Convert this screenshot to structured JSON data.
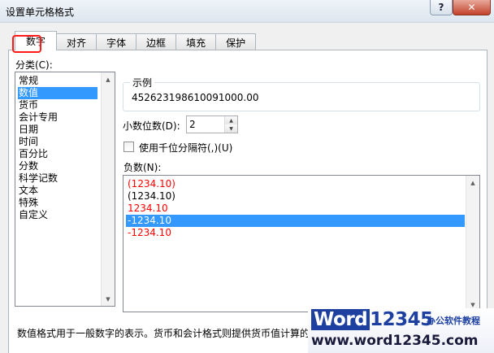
{
  "window": {
    "title": "设置单元格格式",
    "help_label": "?",
    "close_label": "✕"
  },
  "tabs": [
    {
      "label": "数字",
      "active": true
    },
    {
      "label": "对齐"
    },
    {
      "label": "字体"
    },
    {
      "label": "边框"
    },
    {
      "label": "填充"
    },
    {
      "label": "保护"
    }
  ],
  "category": {
    "label": "分类(C):",
    "items": [
      "常规",
      "数值",
      "货币",
      "会计专用",
      "日期",
      "时间",
      "百分比",
      "分数",
      "科学记数",
      "文本",
      "特殊",
      "自定义"
    ],
    "selected": "数值"
  },
  "sample": {
    "label": "示例",
    "value": "452623198610091000.00"
  },
  "decimals": {
    "label": "小数位数(D):",
    "value": "2"
  },
  "thousands": {
    "label": "使用千位分隔符(,)(U)",
    "checked": false
  },
  "negative": {
    "label": "负数(N):",
    "items": [
      {
        "text": "(1234.10)",
        "color": "red"
      },
      {
        "text": "(1234.10)",
        "color": "black"
      },
      {
        "text": "1234.10",
        "color": "red"
      },
      {
        "text": "-1234.10",
        "color": "black",
        "selected": true
      },
      {
        "text": "-1234.10",
        "color": "red"
      }
    ]
  },
  "description": "数值格式用于一般数字的表示。货币和会计格式则提供货币值计算的",
  "watermark": {
    "logo_word": "Word",
    "logo_num": "12345",
    "tagline": "办公软件教程",
    "url": "www.word12345.com"
  },
  "colors": {
    "selection": "#3399ff",
    "negative_red": "#ff0000",
    "annotation": "#ff1a1a",
    "brand": "#1c3fa0"
  }
}
